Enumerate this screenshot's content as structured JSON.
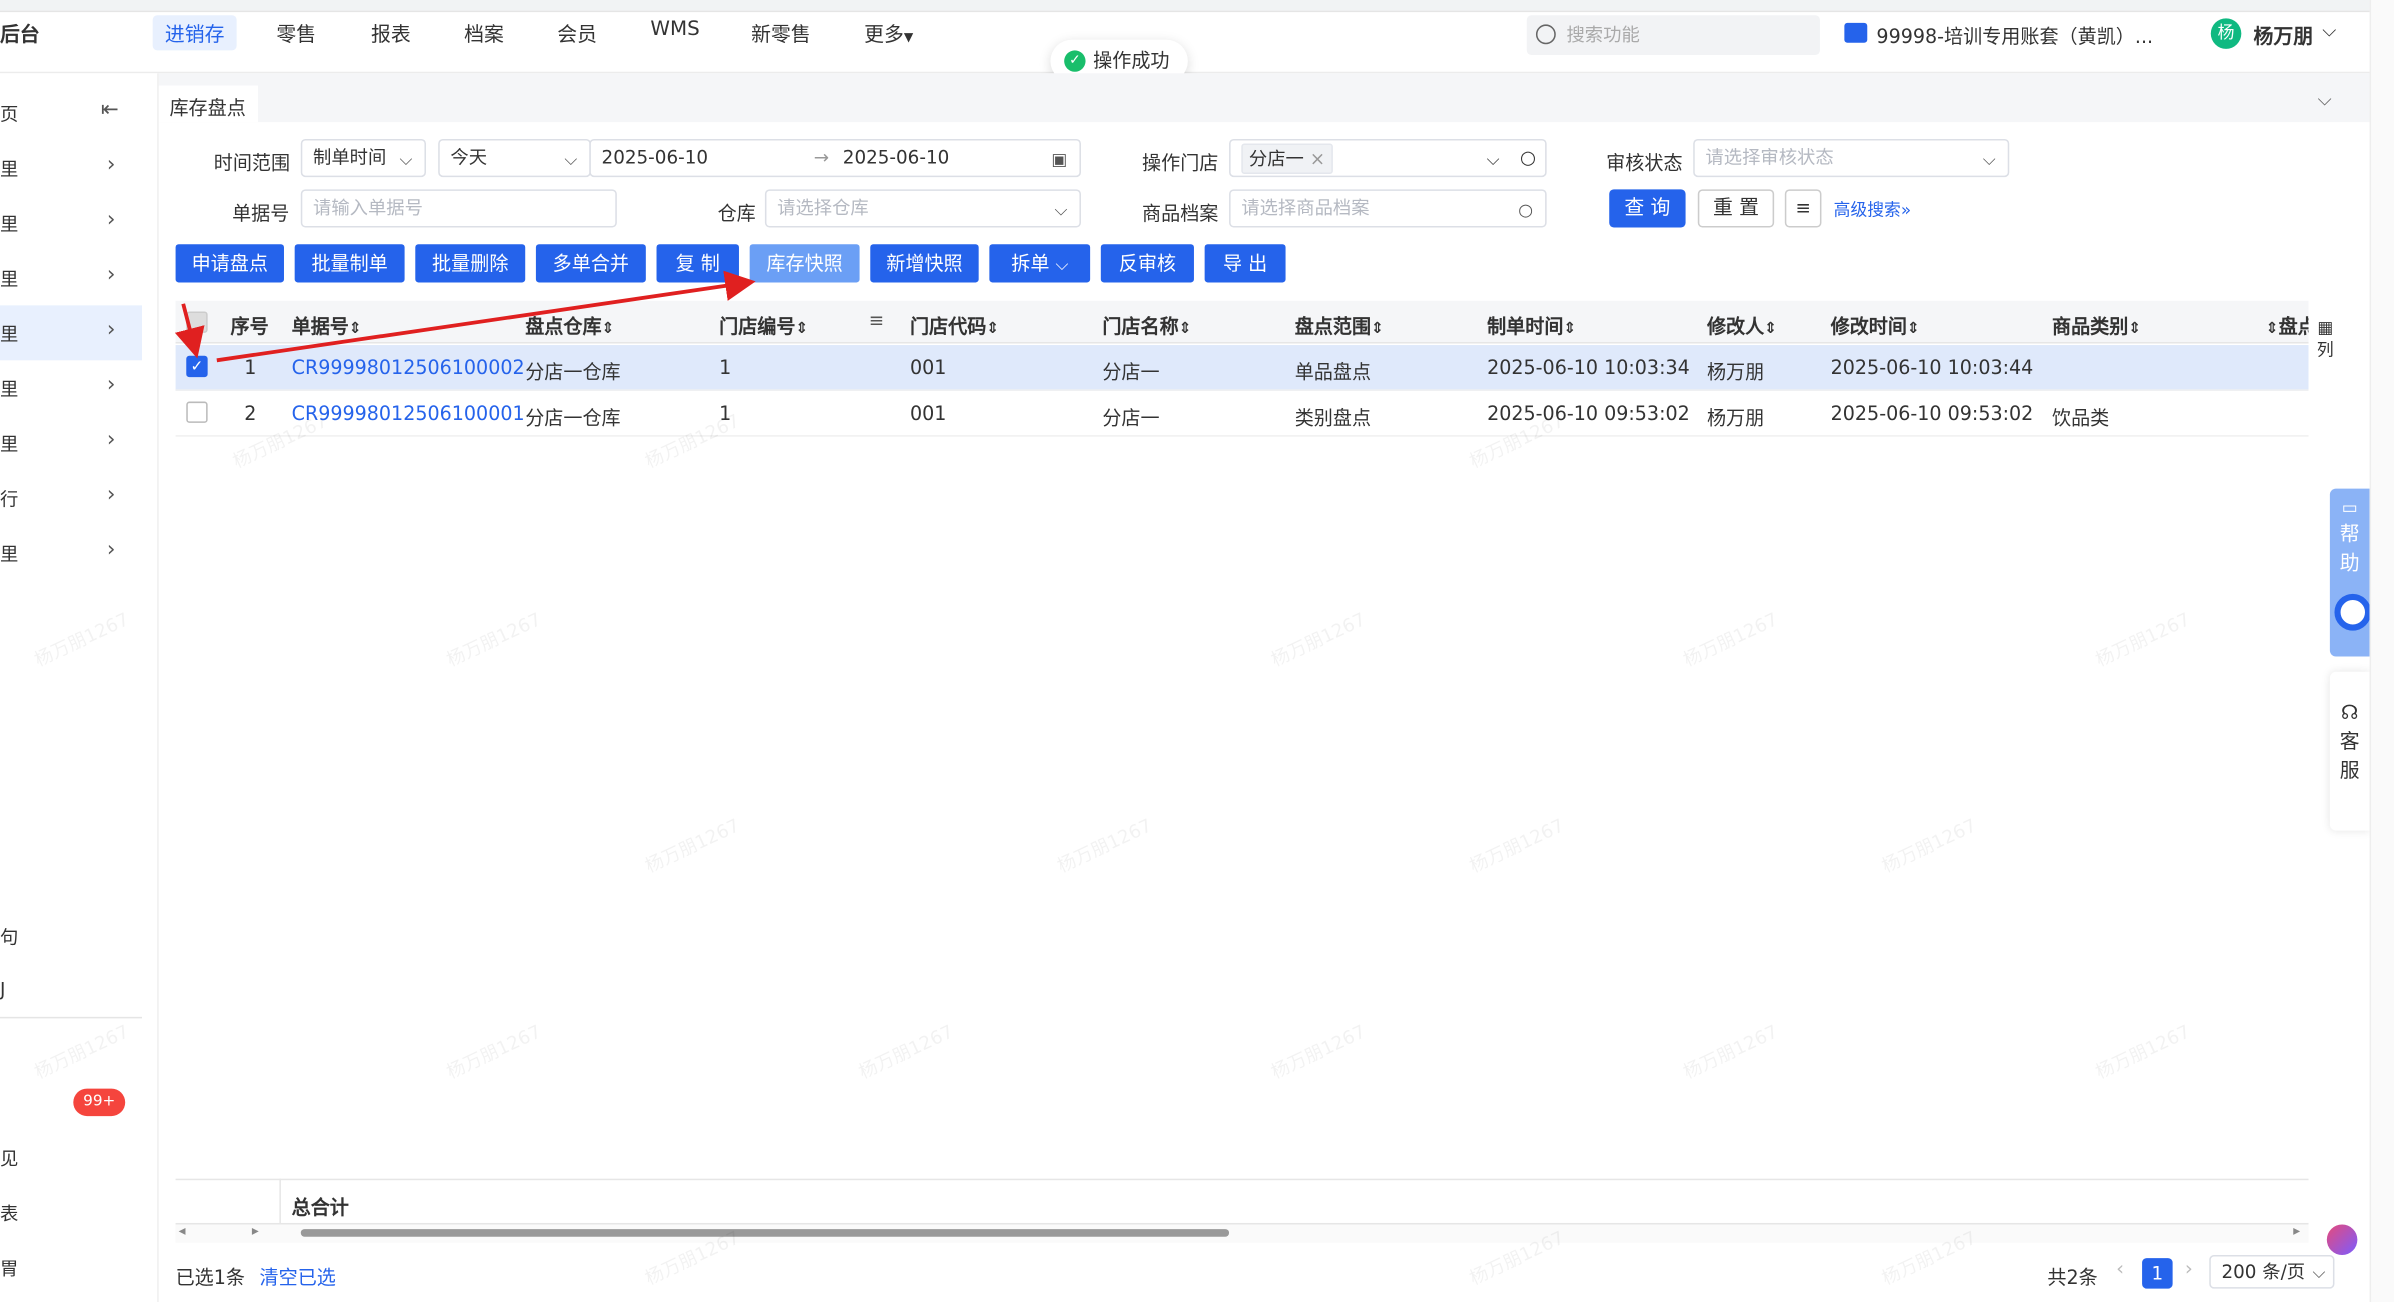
{
  "app": {
    "brand": "后台",
    "nav": [
      "进销存",
      "零售",
      "报表",
      "档案",
      "会员",
      "WMS",
      "新零售",
      "更多"
    ],
    "search_placeholder": "搜索功能",
    "account": "99998-培训专用账套（黄凯）...",
    "user_avatar_char": "杨",
    "user_name": "杨万朋",
    "toast": "操作成功"
  },
  "sidebar": {
    "top_label": "页",
    "items": [
      {
        "label": "里"
      },
      {
        "label": "里"
      },
      {
        "label": "里"
      },
      {
        "label": "里"
      },
      {
        "label": "里"
      },
      {
        "label": "里"
      },
      {
        "label": "行"
      },
      {
        "label": "里"
      }
    ],
    "lower": [
      "句",
      "J",
      "见",
      "表",
      "胃"
    ],
    "badge": "99+"
  },
  "page": {
    "tab": "库存盘点",
    "filters": {
      "time_range_label": "时间范围",
      "time_type": "制单时间",
      "quick_date": "今天",
      "date_from": "2025-06-10",
      "date_to": "2025-06-10",
      "store_label": "操作门店",
      "store_tag": "分店一",
      "audit_label": "审核状态",
      "audit_placeholder": "请选择审核状态",
      "doc_label": "单据号",
      "doc_placeholder": "请输入单据号",
      "warehouse_label": "仓库",
      "warehouse_placeholder": "请选择仓库",
      "goods_label": "商品档案",
      "goods_placeholder": "请选择商品档案",
      "query": "查 询",
      "reset": "重 置",
      "advanced": "高级搜索"
    },
    "actions": [
      "申请盘点",
      "批量制单",
      "批量删除",
      "多单合并",
      "复 制",
      "库存快照",
      "新增快照",
      "拆单",
      "反审核",
      "导 出"
    ],
    "table": {
      "headers": [
        "序号",
        "单据号",
        "盘点仓库",
        "门店编号",
        "门店代码",
        "门店名称",
        "盘点范围",
        "制单时间",
        "修改人",
        "修改时间",
        "商品类别",
        "盘点"
      ],
      "rows": [
        {
          "seq": "1",
          "doc": "CR99998012506100002",
          "warehouse": "分店一仓库",
          "store_no": "1",
          "store_code": "001",
          "store_name": "分店一",
          "scope": "单品盘点",
          "created": "2025-06-10 10:03:34",
          "modifier": "杨万朋",
          "modified": "2025-06-10 10:03:44",
          "category": "",
          "checked": true
        },
        {
          "seq": "2",
          "doc": "CR99998012506100001",
          "warehouse": "分店一仓库",
          "store_no": "1",
          "store_code": "001",
          "store_name": "分店一",
          "scope": "类别盘点",
          "created": "2025-06-10 09:53:02",
          "modifier": "杨万朋",
          "modified": "2025-06-10 09:53:02",
          "category": "饮品类",
          "checked": false
        }
      ],
      "total_label": "总合计",
      "col_setting": "列"
    },
    "footer": {
      "selected": "已选1条",
      "clear": "清空已选",
      "total": "共2条",
      "page": "1",
      "page_size": "200 条/页"
    }
  },
  "float": {
    "help": [
      "帮",
      "助"
    ],
    "kefu": [
      "客",
      "服"
    ]
  },
  "watermark": "杨万朋1267",
  "colors": {
    "primary": "#2563eb",
    "selected_row": "#dfe9fb",
    "arrow": "#e02020"
  }
}
